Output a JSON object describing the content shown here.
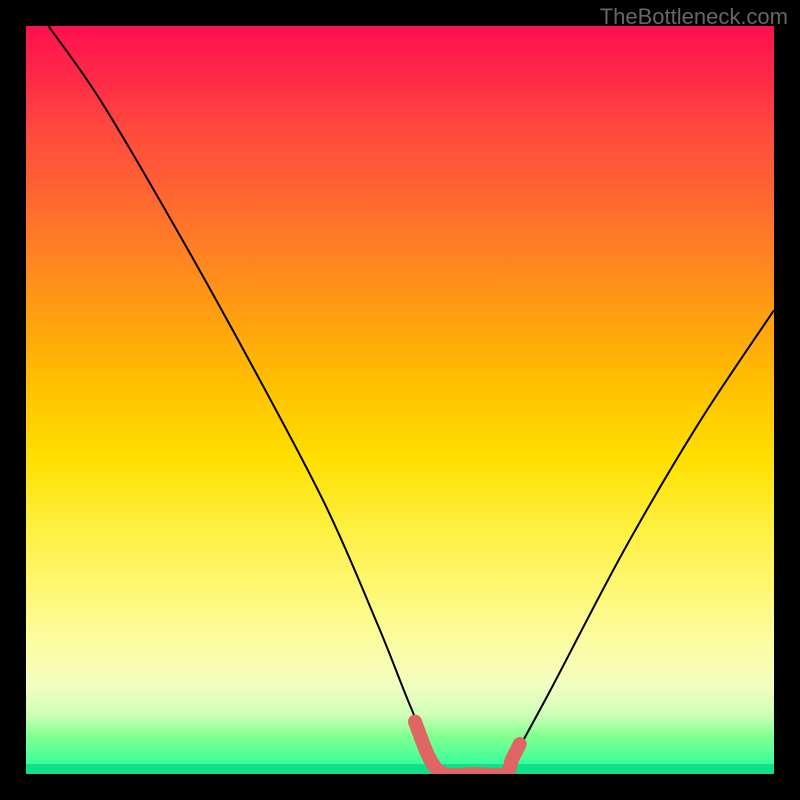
{
  "watermark": "TheBottleneck.com",
  "chart_data": {
    "type": "line",
    "title": "",
    "xlabel": "",
    "ylabel": "",
    "xlim": [
      0,
      100
    ],
    "ylim": [
      0,
      100
    ],
    "series": [
      {
        "name": "left-curve",
        "x": [
          3,
          10,
          20,
          30,
          40,
          47,
          51,
          54,
          56
        ],
        "values": [
          100,
          90,
          73,
          55,
          36,
          20,
          10,
          3,
          0
        ]
      },
      {
        "name": "floor-segment",
        "x": [
          56,
          64
        ],
        "values": [
          0,
          0
        ]
      },
      {
        "name": "right-curve",
        "x": [
          64,
          70,
          80,
          90,
          100
        ],
        "values": [
          0,
          11,
          30,
          47,
          62
        ]
      }
    ],
    "highlight": {
      "name": "pink-band",
      "color": "#e06565",
      "x": [
        52,
        54,
        56,
        60,
        64,
        65,
        66
      ],
      "values": [
        7,
        2,
        0,
        0,
        0,
        2,
        4
      ]
    }
  }
}
